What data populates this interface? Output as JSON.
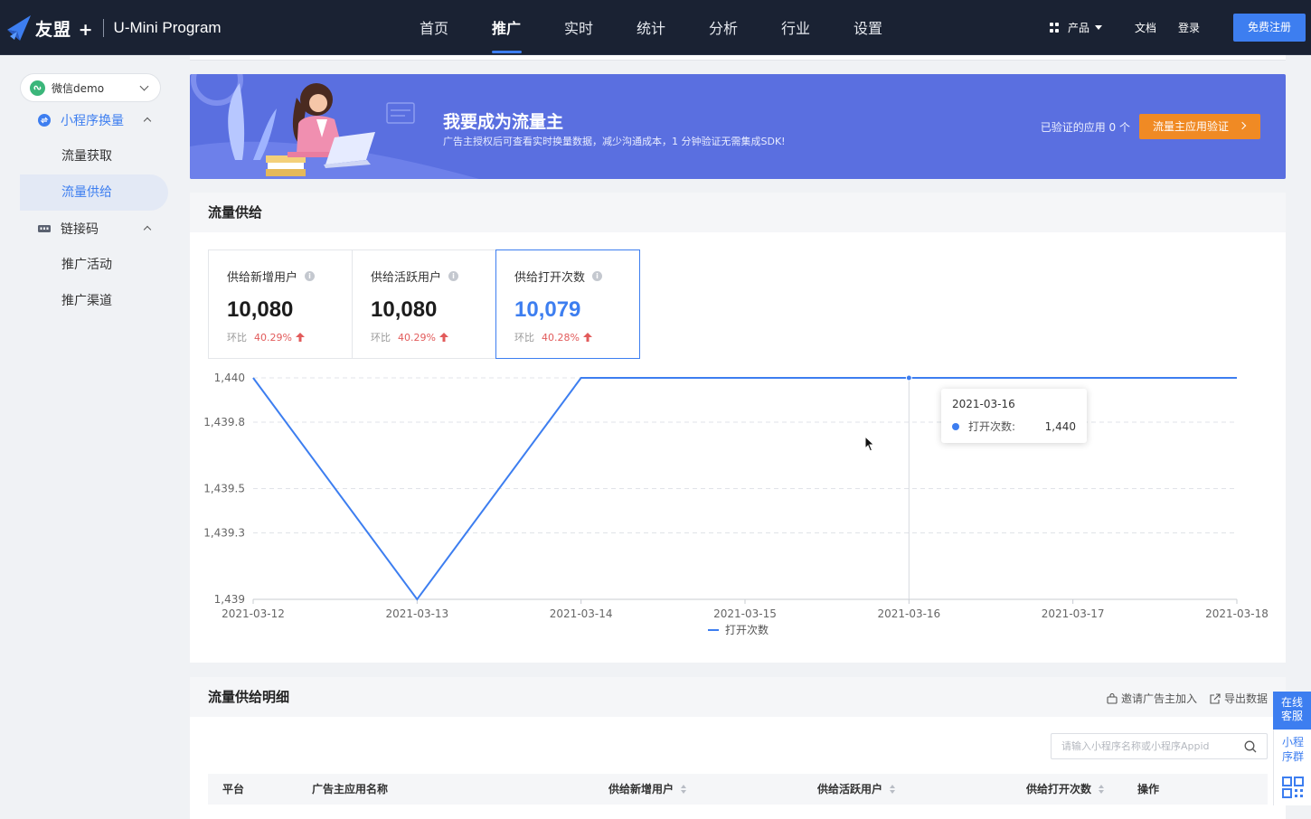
{
  "header": {
    "brand": "友盟 +",
    "product": "U-Mini Program",
    "tabs": [
      {
        "label": "首页"
      },
      {
        "label": "推广",
        "active": true
      },
      {
        "label": "实时"
      },
      {
        "label": "统计"
      },
      {
        "label": "分析"
      },
      {
        "label": "行业"
      },
      {
        "label": "设置"
      }
    ],
    "products_label": "产品",
    "docs_label": "文档",
    "login_label": "登录",
    "signup_label": "免费注册"
  },
  "sidebar": {
    "app_select": "微信demo",
    "groups": [
      {
        "label": "小程序换量",
        "items": [
          {
            "label": "流量获取"
          },
          {
            "label": "流量供给",
            "active": true
          }
        ]
      },
      {
        "label": "链接码",
        "items": [
          {
            "label": "推广活动"
          },
          {
            "label": "推广渠道"
          }
        ]
      }
    ]
  },
  "banner": {
    "title": "我要成为流量主",
    "subtitle": "广告主授权后可查看实时换量数据，减少沟通成本，1 分钟验证无需集成SDK!",
    "verified_count": "已验证的应用 0 个",
    "button": "流量主应用验证"
  },
  "supply": {
    "title": "流量供给",
    "stats": [
      {
        "name": "供给新增用户",
        "value": "10,080",
        "ratio_label": "环比",
        "ratio": "40.29%"
      },
      {
        "name": "供给活跃用户",
        "value": "10,080",
        "ratio_label": "环比",
        "ratio": "40.29%"
      },
      {
        "name": "供给打开次数",
        "value": "10,079",
        "ratio_label": "环比",
        "ratio": "40.28%",
        "selected": true
      }
    ],
    "tooltip": {
      "date": "2021-03-16",
      "series": "打开次数:",
      "value": "1,440"
    }
  },
  "chart_data": {
    "type": "line",
    "x": [
      "2021-03-12",
      "2021-03-13",
      "2021-03-14",
      "2021-03-15",
      "2021-03-16",
      "2021-03-17",
      "2021-03-18"
    ],
    "series": [
      {
        "name": "打开次数",
        "values": [
          1440,
          1439,
          1440,
          1440,
          1440,
          1440,
          1440
        ]
      }
    ],
    "y_ticks": [
      "1,440",
      "1,439.8",
      "1,439.5",
      "1,439.3",
      "1,439"
    ],
    "y_tick_values": [
      1440,
      1439.8,
      1439.5,
      1439.3,
      1439
    ],
    "ylim": [
      1439,
      1440
    ],
    "grid": true,
    "legend": "bottom-center",
    "color": "#3d7ef0",
    "highlight_index": 4
  },
  "detail": {
    "title": "流量供给明细",
    "invite_label": "邀请广告主加入",
    "export_label": "导出数据",
    "search_placeholder": "请输入小程序名称或小程序Appid",
    "columns": [
      "平台",
      "广告主应用名称",
      "供给新增用户",
      "供给活跃用户",
      "供给打开次数",
      "操作"
    ]
  },
  "service": {
    "online_l1": "在线",
    "online_l2": "客服",
    "group_l1": "小程",
    "group_l2": "序群"
  }
}
